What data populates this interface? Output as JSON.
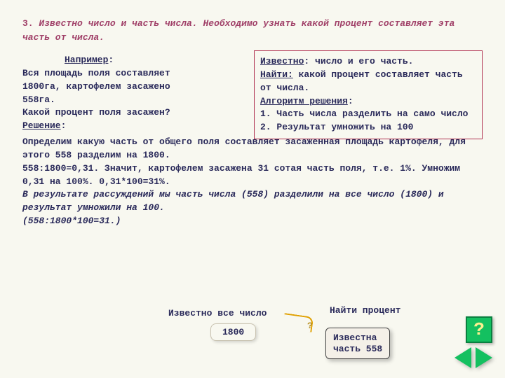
{
  "title": {
    "num": "3.",
    "text": "Известно число и часть числа. Необходимо узнать какой процент составляет эта часть от числа."
  },
  "infobox": {
    "known_label": "Известно",
    "known_text": ": число и его часть.",
    "find_label": "Найти:",
    "find_text": " какой процент составляет часть от числа.",
    "algo_label": "Алгоритм решения",
    "step1": "1. Часть числа разделить на само число",
    "step2": "2. Результат умножить на 100"
  },
  "example": {
    "naprimer": "Например",
    "l1": "Вся площадь поля составляет",
    "l2": "1800га, картофелем засажено",
    "l3": "558га.",
    "l4": "Какой процент поля засажен?",
    "reshenie": "Решение",
    "p1": "Определим какую часть от общего поля составляет засаженная площадь картофеля, для этого 558 разделим на 1800.",
    "p2": "558:1800=0,31. Значит, картофелем засажена 31 сотая часть поля, т.е. 1%. Умножим 0,31 на 100%. 0,31*100=31%.",
    "p3": "В результате рассуждений мы часть числа (558) разделили на все число (1800) и результат умножили на 100.",
    "p4": "(558:1800*100=31.)"
  },
  "bottom": {
    "all_label": "Известно все число",
    "all_value": "1800",
    "find_label": "Найти процент",
    "q": "?",
    "part_label": "Известна",
    "part_value": "часть 558"
  },
  "nav": {
    "help": "?"
  }
}
